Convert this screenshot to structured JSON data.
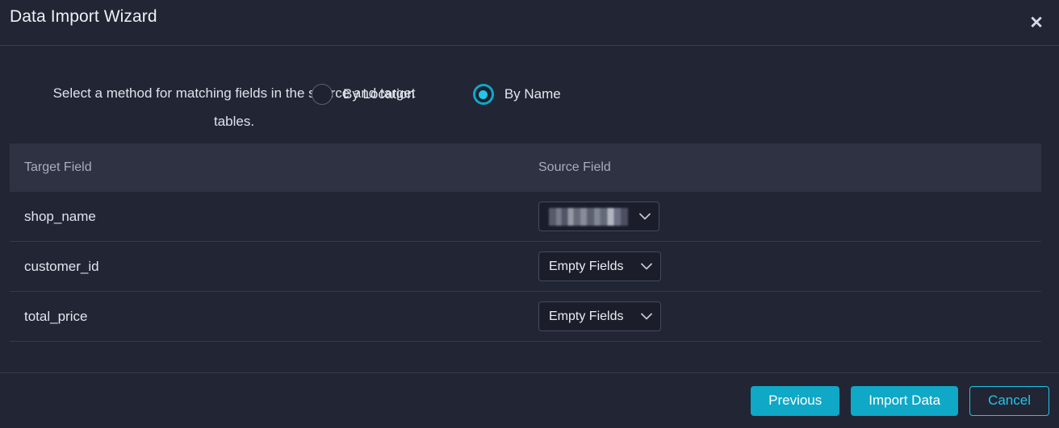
{
  "window": {
    "title": "Data Import Wizard",
    "close_icon": "close-icon",
    "close_glyph": "✕"
  },
  "instruction": {
    "text": "Select a method for matching fields in the source and target tables."
  },
  "match_method": {
    "options": [
      {
        "label": "By Location",
        "selected": false
      },
      {
        "label": "By Name",
        "selected": true
      }
    ]
  },
  "mapping_table": {
    "columns": [
      "Target Field",
      "Source Field"
    ],
    "rows": [
      {
        "target_field": "shop_name",
        "source_field": "",
        "redacted": true
      },
      {
        "target_field": "customer_id",
        "source_field": "Empty Fields",
        "redacted": false
      },
      {
        "target_field": "total_price",
        "source_field": "Empty Fields",
        "redacted": false
      }
    ]
  },
  "footer": {
    "previous_label": "Previous",
    "import_label": "Import Data",
    "cancel_label": "Cancel"
  },
  "colors": {
    "accent": "#0fa8c6",
    "accent_bright": "#23c5e8",
    "background": "#212534",
    "header_row": "#2e3242",
    "field_background": "#1b1e2a",
    "divider": "#363b4d"
  },
  "icons": {
    "chevron_down": "chevron-down-icon"
  }
}
